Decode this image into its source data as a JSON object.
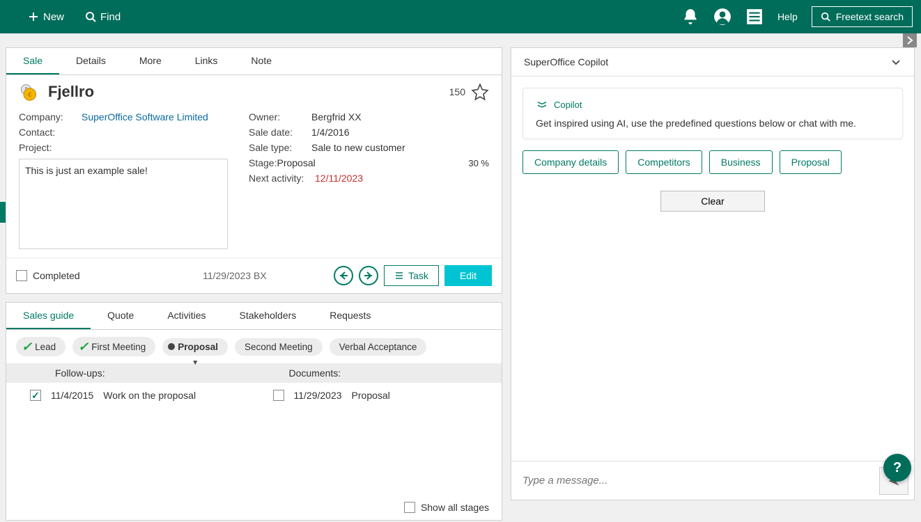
{
  "topbar": {
    "new_label": "New",
    "find_label": "Find",
    "help_label": "Help",
    "freetext_label": "Freetext search"
  },
  "sale_tabs": [
    "Sale",
    "Details",
    "More",
    "Links",
    "Note"
  ],
  "sale": {
    "title": "Fjellro",
    "score": "150",
    "fields": {
      "company_label": "Company:",
      "company_value": "SuperOffice Software Limited",
      "contact_label": "Contact:",
      "contact_value": "",
      "project_label": "Project:",
      "project_value": "",
      "note": "This is just an example sale!",
      "owner_label": "Owner:",
      "owner_value": "Bergfrid XX",
      "saledate_label": "Sale date:",
      "saledate_value": "1/4/2016",
      "saletype_label": "Sale type:",
      "saletype_value": "Sale to new customer",
      "stage_label": "Stage:",
      "stage_value": "Proposal",
      "stage_pct": "30 %",
      "nextact_label": "Next activity:",
      "nextact_value": "12/11/2023"
    },
    "footer": {
      "completed_label": "Completed",
      "meta": "11/29/2023 BX",
      "task_label": "Task",
      "edit_label": "Edit"
    }
  },
  "guide_tabs": [
    "Sales guide",
    "Quote",
    "Activities",
    "Stakeholders",
    "Requests"
  ],
  "stages": {
    "lead": "Lead",
    "first_meeting": "First Meeting",
    "proposal": "Proposal",
    "second_meeting": "Second Meeting",
    "verbal": "Verbal Acceptance"
  },
  "guide_cols": {
    "followups": "Follow-ups:",
    "documents": "Documents:"
  },
  "guide_rows": {
    "f_date": "11/4/2015",
    "f_text": "Work on the proposal",
    "d_date": "11/29/2023",
    "d_text": "Proposal"
  },
  "guide_footer": {
    "show_all": "Show all stages"
  },
  "copilot": {
    "title": "SuperOffice Copilot",
    "brand": "Copilot",
    "intro": "Get inspired using AI, use the predefined questions below or chat with me.",
    "suggestions": [
      "Company details",
      "Competitors",
      "Business",
      "Proposal"
    ],
    "clear": "Clear",
    "placeholder": "Type a message..."
  }
}
